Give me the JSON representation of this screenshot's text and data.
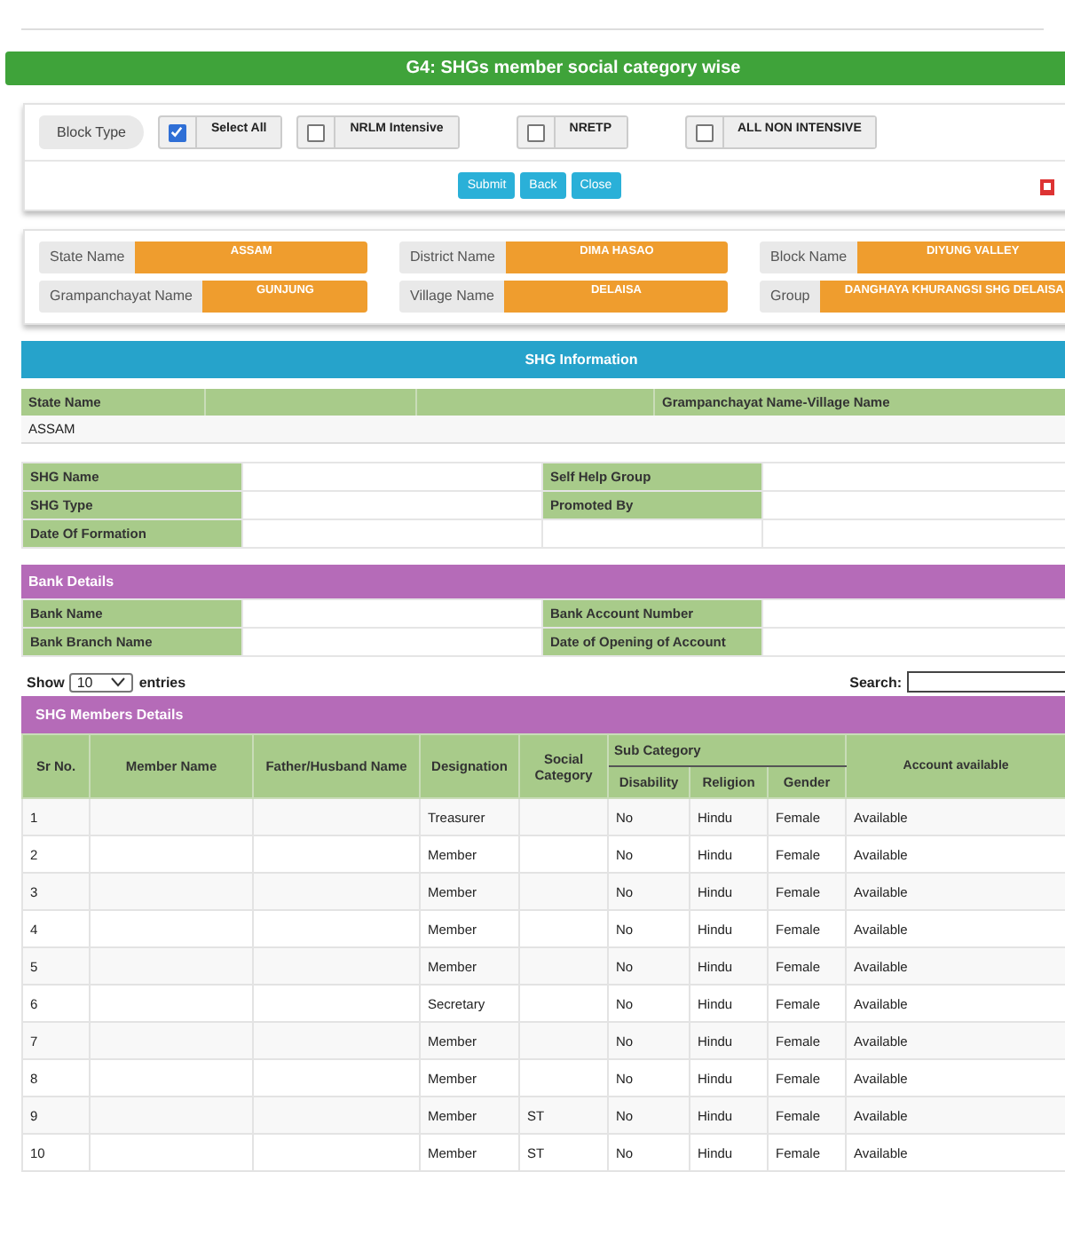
{
  "title": "G4: SHGs member social category wise",
  "filter": {
    "label": "Block Type",
    "options": [
      {
        "label": "Select All",
        "checked": true
      },
      {
        "label": "NRLM Intensive",
        "checked": false
      },
      {
        "label": "NRETP",
        "checked": false
      },
      {
        "label": "ALL NON INTENSIVE",
        "checked": false
      }
    ],
    "buttons": [
      "Submit",
      "Back",
      "Close"
    ]
  },
  "location": [
    {
      "label": "State Name",
      "value": "ASSAM"
    },
    {
      "label": "District Name",
      "value": "DIMA HASAO"
    },
    {
      "label": "Block Name",
      "value": "DIYUNG VALLEY"
    },
    {
      "label": "Grampanchayat Name",
      "value": "GUNJUNG"
    },
    {
      "label": "Village Name",
      "value": "DELAISA"
    },
    {
      "label": "Group",
      "value": "DANGHAYA KHURANGSI SHG DELAISA"
    }
  ],
  "shg_information": {
    "title": "SHG Information",
    "columns": [
      "State Name",
      "",
      "",
      "Grampanchayat Name-Village Name"
    ],
    "row": [
      "ASSAM"
    ]
  },
  "shg_details": [
    {
      "label": "SHG Name",
      "label2": "Self Help Group"
    },
    {
      "label": "SHG Type",
      "label2": "Promoted By"
    },
    {
      "label": "Date Of Formation"
    }
  ],
  "bank_details": {
    "title": "Bank Details",
    "rows": [
      {
        "label": "Bank Name",
        "label2": "Bank Account Number"
      },
      {
        "label": "Bank Branch Name",
        "label2": "Date of Opening of Account"
      }
    ]
  },
  "entries": {
    "show": "Show",
    "value": "10",
    "suffix": "entries",
    "search": "Search:"
  },
  "members": {
    "title": "SHG Members Details",
    "columns": [
      "Sr No.",
      "Member Name",
      "Father/Husband Name",
      "Designation",
      "Social Category"
    ],
    "group": "Sub Category",
    "sub_columns": [
      "Disability",
      "Religion",
      "Gender"
    ],
    "last_column": "Account available",
    "rows": [
      {
        "sr": "1",
        "designation": "Treasurer",
        "social": "",
        "disability": "No",
        "religion": "Hindu",
        "gender": "Female",
        "account": "Available"
      },
      {
        "sr": "2",
        "designation": "Member",
        "social": "",
        "disability": "No",
        "religion": "Hindu",
        "gender": "Female",
        "account": "Available"
      },
      {
        "sr": "3",
        "designation": "Member",
        "social": "",
        "disability": "No",
        "religion": "Hindu",
        "gender": "Female",
        "account": "Available"
      },
      {
        "sr": "4",
        "designation": "Member",
        "social": "",
        "disability": "No",
        "religion": "Hindu",
        "gender": "Female",
        "account": "Available"
      },
      {
        "sr": "5",
        "designation": "Member",
        "social": "",
        "disability": "No",
        "religion": "Hindu",
        "gender": "Female",
        "account": "Available"
      },
      {
        "sr": "6",
        "designation": "Secretary",
        "social": "",
        "disability": "No",
        "religion": "Hindu",
        "gender": "Female",
        "account": "Available"
      },
      {
        "sr": "7",
        "designation": "Member",
        "social": "",
        "disability": "No",
        "religion": "Hindu",
        "gender": "Female",
        "account": "Available"
      },
      {
        "sr": "8",
        "designation": "Member",
        "social": "",
        "disability": "No",
        "religion": "Hindu",
        "gender": "Female",
        "account": "Available"
      },
      {
        "sr": "9",
        "designation": "Member",
        "social": "ST",
        "disability": "No",
        "religion": "Hindu",
        "gender": "Female",
        "account": "Available"
      },
      {
        "sr": "10",
        "designation": "Member",
        "social": "ST",
        "disability": "No",
        "religion": "Hindu",
        "gender": "Female",
        "account": "Available"
      }
    ]
  }
}
